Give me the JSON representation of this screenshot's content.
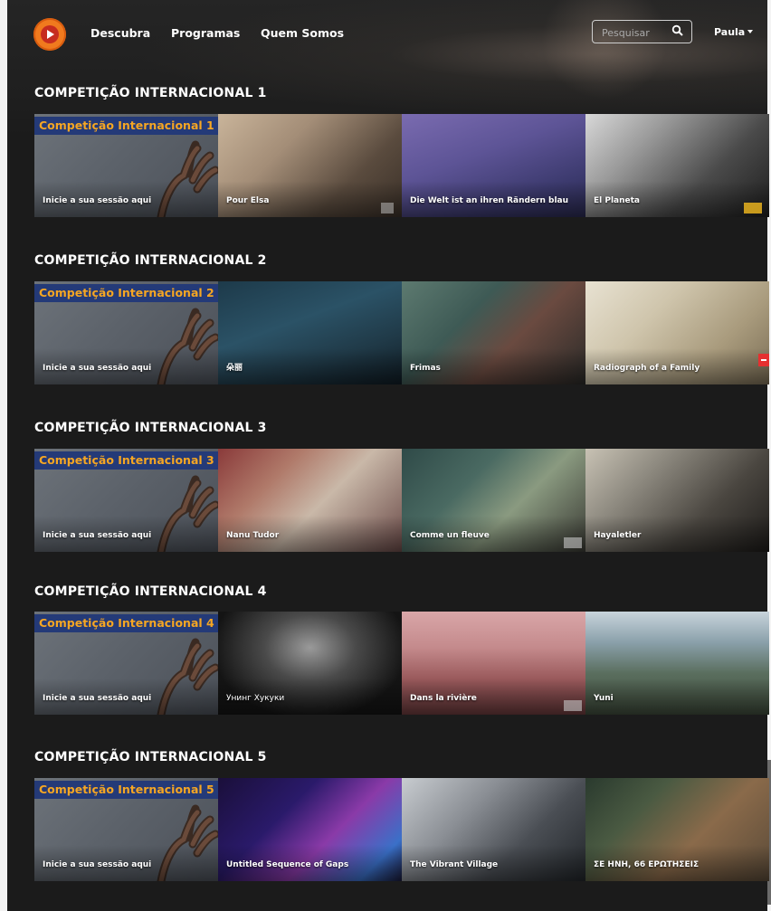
{
  "header": {
    "nav": [
      "Descubra",
      "Programas",
      "Quem Somos"
    ],
    "search_placeholder": "Pesquisar",
    "user_name": "Paula"
  },
  "sections": [
    {
      "title": "COMPETIÇÃO INTERNACIONAL 1",
      "promo_banner": "Competição Internacional 1",
      "promo_caption": "Inicie a sua sessão aqui",
      "films": [
        "Pour Elsa",
        "Die Welt ist an ihren Rändern blau",
        "El Planeta"
      ]
    },
    {
      "title": "COMPETIÇÃO INTERNACIONAL 2",
      "promo_banner": "Competição Internacional 2",
      "promo_caption": "Inicie a sua sessão aqui",
      "films": [
        "朵丽",
        "Frimas",
        "Radiograph of a Family"
      ]
    },
    {
      "title": "COMPETIÇÃO INTERNACIONAL 3",
      "promo_banner": "Competição Internacional 3",
      "promo_caption": "Inicie a sua sessão aqui",
      "films": [
        "Nanu Tudor",
        "Comme un fleuve",
        "Hayaletler"
      ]
    },
    {
      "title": "COMPETIÇÃO INTERNACIONAL 4",
      "promo_banner": "Competição Internacional 4",
      "promo_caption": "Inicie a sua sessão aqui",
      "films": [
        "Унинг Хукуки",
        "Dans la rivière",
        "Yuni"
      ]
    },
    {
      "title": "COMPETIÇÃO INTERNACIONAL 5",
      "promo_banner": "Competição Internacional 5",
      "promo_caption": "Inicie a sua sessão aqui",
      "films": [
        "Untitled Sequence of Gaps",
        "The Vibrant Village",
        "ΣΕ ΗΝΗ, 66 ΕΡΩΤΗΣΕΙΣ"
      ]
    }
  ],
  "colors": {
    "accent_orange": "#f5a623",
    "banner_blue": "#243a78",
    "logo_orange": "#f07a1e",
    "background": "#1b1b1b"
  }
}
